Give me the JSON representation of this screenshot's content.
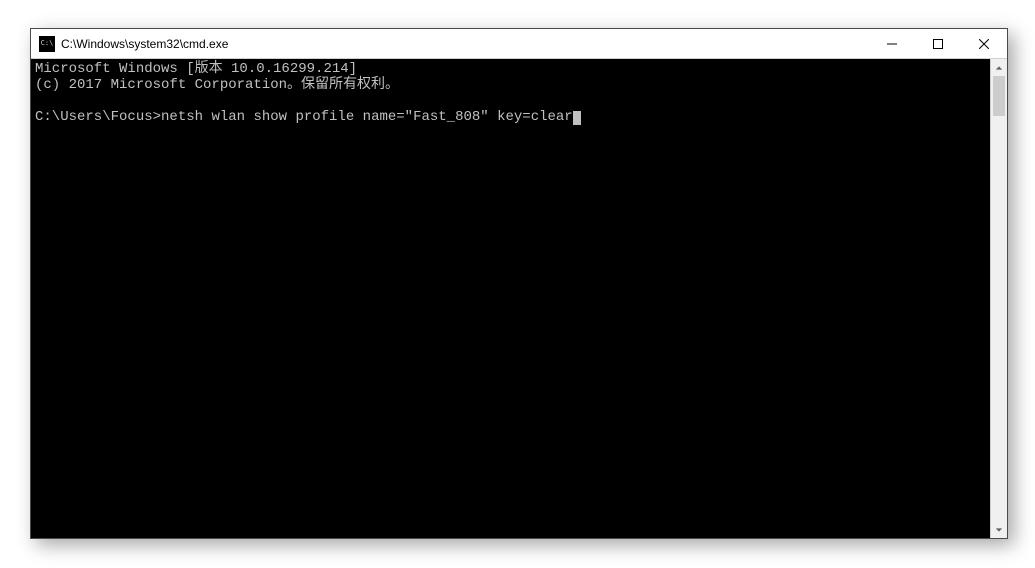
{
  "window": {
    "title": "C:\\Windows\\system32\\cmd.exe"
  },
  "terminal": {
    "line1": "Microsoft Windows [版本 10.0.16299.214]",
    "line2": "(c) 2017 Microsoft Corporation。保留所有权利。",
    "blank": "",
    "prompt": "C:\\Users\\Focus>",
    "command": "netsh wlan show profile name=\"Fast_808\" key=clear"
  }
}
